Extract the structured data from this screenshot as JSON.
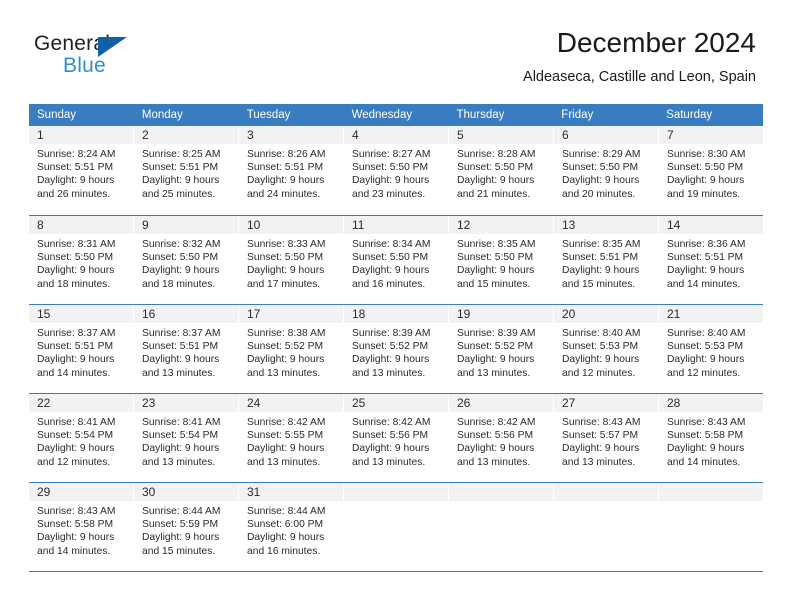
{
  "brand": {
    "name_part1": "General",
    "name_part2": "Blue",
    "triangle_color": "#1060a8",
    "blue_color": "#2e8fd4"
  },
  "header": {
    "title": "December 2024",
    "subtitle": "Aldeaseca, Castille and Leon, Spain"
  },
  "calendar": {
    "accent_color": "#3a7cc0",
    "day_number_bg": "#f2f2f2",
    "weekdays": [
      "Sunday",
      "Monday",
      "Tuesday",
      "Wednesday",
      "Thursday",
      "Friday",
      "Saturday"
    ],
    "weeks": [
      [
        {
          "day": "1",
          "sunrise": "Sunrise: 8:24 AM",
          "sunset": "Sunset: 5:51 PM",
          "daylight1": "Daylight: 9 hours",
          "daylight2": "and 26 minutes."
        },
        {
          "day": "2",
          "sunrise": "Sunrise: 8:25 AM",
          "sunset": "Sunset: 5:51 PM",
          "daylight1": "Daylight: 9 hours",
          "daylight2": "and 25 minutes."
        },
        {
          "day": "3",
          "sunrise": "Sunrise: 8:26 AM",
          "sunset": "Sunset: 5:51 PM",
          "daylight1": "Daylight: 9 hours",
          "daylight2": "and 24 minutes."
        },
        {
          "day": "4",
          "sunrise": "Sunrise: 8:27 AM",
          "sunset": "Sunset: 5:50 PM",
          "daylight1": "Daylight: 9 hours",
          "daylight2": "and 23 minutes."
        },
        {
          "day": "5",
          "sunrise": "Sunrise: 8:28 AM",
          "sunset": "Sunset: 5:50 PM",
          "daylight1": "Daylight: 9 hours",
          "daylight2": "and 21 minutes."
        },
        {
          "day": "6",
          "sunrise": "Sunrise: 8:29 AM",
          "sunset": "Sunset: 5:50 PM",
          "daylight1": "Daylight: 9 hours",
          "daylight2": "and 20 minutes."
        },
        {
          "day": "7",
          "sunrise": "Sunrise: 8:30 AM",
          "sunset": "Sunset: 5:50 PM",
          "daylight1": "Daylight: 9 hours",
          "daylight2": "and 19 minutes."
        }
      ],
      [
        {
          "day": "8",
          "sunrise": "Sunrise: 8:31 AM",
          "sunset": "Sunset: 5:50 PM",
          "daylight1": "Daylight: 9 hours",
          "daylight2": "and 18 minutes."
        },
        {
          "day": "9",
          "sunrise": "Sunrise: 8:32 AM",
          "sunset": "Sunset: 5:50 PM",
          "daylight1": "Daylight: 9 hours",
          "daylight2": "and 18 minutes."
        },
        {
          "day": "10",
          "sunrise": "Sunrise: 8:33 AM",
          "sunset": "Sunset: 5:50 PM",
          "daylight1": "Daylight: 9 hours",
          "daylight2": "and 17 minutes."
        },
        {
          "day": "11",
          "sunrise": "Sunrise: 8:34 AM",
          "sunset": "Sunset: 5:50 PM",
          "daylight1": "Daylight: 9 hours",
          "daylight2": "and 16 minutes."
        },
        {
          "day": "12",
          "sunrise": "Sunrise: 8:35 AM",
          "sunset": "Sunset: 5:50 PM",
          "daylight1": "Daylight: 9 hours",
          "daylight2": "and 15 minutes."
        },
        {
          "day": "13",
          "sunrise": "Sunrise: 8:35 AM",
          "sunset": "Sunset: 5:51 PM",
          "daylight1": "Daylight: 9 hours",
          "daylight2": "and 15 minutes."
        },
        {
          "day": "14",
          "sunrise": "Sunrise: 8:36 AM",
          "sunset": "Sunset: 5:51 PM",
          "daylight1": "Daylight: 9 hours",
          "daylight2": "and 14 minutes."
        }
      ],
      [
        {
          "day": "15",
          "sunrise": "Sunrise: 8:37 AM",
          "sunset": "Sunset: 5:51 PM",
          "daylight1": "Daylight: 9 hours",
          "daylight2": "and 14 minutes."
        },
        {
          "day": "16",
          "sunrise": "Sunrise: 8:37 AM",
          "sunset": "Sunset: 5:51 PM",
          "daylight1": "Daylight: 9 hours",
          "daylight2": "and 13 minutes."
        },
        {
          "day": "17",
          "sunrise": "Sunrise: 8:38 AM",
          "sunset": "Sunset: 5:52 PM",
          "daylight1": "Daylight: 9 hours",
          "daylight2": "and 13 minutes."
        },
        {
          "day": "18",
          "sunrise": "Sunrise: 8:39 AM",
          "sunset": "Sunset: 5:52 PM",
          "daylight1": "Daylight: 9 hours",
          "daylight2": "and 13 minutes."
        },
        {
          "day": "19",
          "sunrise": "Sunrise: 8:39 AM",
          "sunset": "Sunset: 5:52 PM",
          "daylight1": "Daylight: 9 hours",
          "daylight2": "and 13 minutes."
        },
        {
          "day": "20",
          "sunrise": "Sunrise: 8:40 AM",
          "sunset": "Sunset: 5:53 PM",
          "daylight1": "Daylight: 9 hours",
          "daylight2": "and 12 minutes."
        },
        {
          "day": "21",
          "sunrise": "Sunrise: 8:40 AM",
          "sunset": "Sunset: 5:53 PM",
          "daylight1": "Daylight: 9 hours",
          "daylight2": "and 12 minutes."
        }
      ],
      [
        {
          "day": "22",
          "sunrise": "Sunrise: 8:41 AM",
          "sunset": "Sunset: 5:54 PM",
          "daylight1": "Daylight: 9 hours",
          "daylight2": "and 12 minutes."
        },
        {
          "day": "23",
          "sunrise": "Sunrise: 8:41 AM",
          "sunset": "Sunset: 5:54 PM",
          "daylight1": "Daylight: 9 hours",
          "daylight2": "and 13 minutes."
        },
        {
          "day": "24",
          "sunrise": "Sunrise: 8:42 AM",
          "sunset": "Sunset: 5:55 PM",
          "daylight1": "Daylight: 9 hours",
          "daylight2": "and 13 minutes."
        },
        {
          "day": "25",
          "sunrise": "Sunrise: 8:42 AM",
          "sunset": "Sunset: 5:56 PM",
          "daylight1": "Daylight: 9 hours",
          "daylight2": "and 13 minutes."
        },
        {
          "day": "26",
          "sunrise": "Sunrise: 8:42 AM",
          "sunset": "Sunset: 5:56 PM",
          "daylight1": "Daylight: 9 hours",
          "daylight2": "and 13 minutes."
        },
        {
          "day": "27",
          "sunrise": "Sunrise: 8:43 AM",
          "sunset": "Sunset: 5:57 PM",
          "daylight1": "Daylight: 9 hours",
          "daylight2": "and 13 minutes."
        },
        {
          "day": "28",
          "sunrise": "Sunrise: 8:43 AM",
          "sunset": "Sunset: 5:58 PM",
          "daylight1": "Daylight: 9 hours",
          "daylight2": "and 14 minutes."
        }
      ],
      [
        {
          "day": "29",
          "sunrise": "Sunrise: 8:43 AM",
          "sunset": "Sunset: 5:58 PM",
          "daylight1": "Daylight: 9 hours",
          "daylight2": "and 14 minutes."
        },
        {
          "day": "30",
          "sunrise": "Sunrise: 8:44 AM",
          "sunset": "Sunset: 5:59 PM",
          "daylight1": "Daylight: 9 hours",
          "daylight2": "and 15 minutes."
        },
        {
          "day": "31",
          "sunrise": "Sunrise: 8:44 AM",
          "sunset": "Sunset: 6:00 PM",
          "daylight1": "Daylight: 9 hours",
          "daylight2": "and 16 minutes."
        },
        {
          "day": "",
          "sunrise": "",
          "sunset": "",
          "daylight1": "",
          "daylight2": ""
        },
        {
          "day": "",
          "sunrise": "",
          "sunset": "",
          "daylight1": "",
          "daylight2": ""
        },
        {
          "day": "",
          "sunrise": "",
          "sunset": "",
          "daylight1": "",
          "daylight2": ""
        },
        {
          "day": "",
          "sunrise": "",
          "sunset": "",
          "daylight1": "",
          "daylight2": ""
        }
      ]
    ]
  }
}
